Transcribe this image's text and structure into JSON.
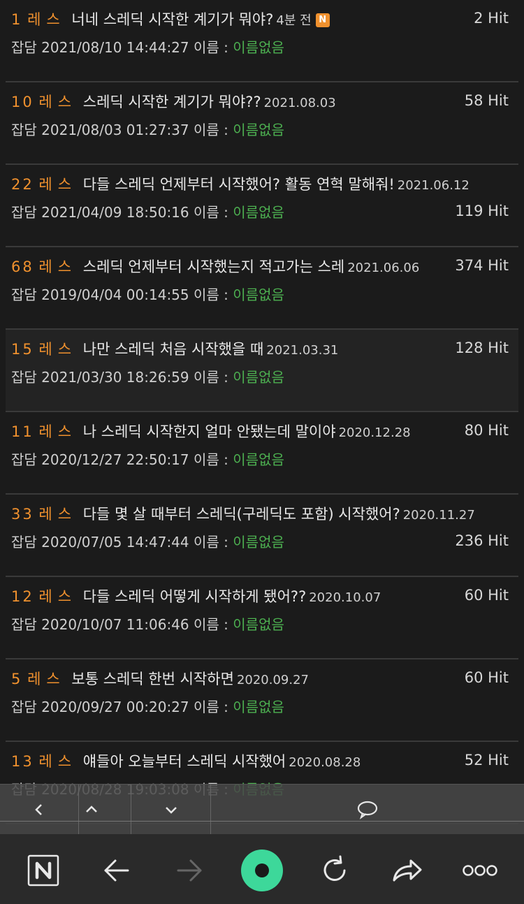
{
  "posts": [
    {
      "num": "1",
      "res": "레스",
      "title": "너네 스레딕 시작한 계기가 뭐야?",
      "date": "4분 전",
      "badge": "N",
      "hit": "2 Hit",
      "hit_pos": "top",
      "board": "잡담",
      "created": "2021/08/10 14:44:27",
      "name_label": "이름 :",
      "name": "이름없음",
      "highlight": false
    },
    {
      "num": "10",
      "res": "레스",
      "title": "스레딕 시작한 계기가 뭐야??",
      "date": "2021.08.03",
      "hit": "58 Hit",
      "hit_pos": "top",
      "board": "잡담",
      "created": "2021/08/03 01:27:37",
      "name_label": "이름 :",
      "name": "이름없음",
      "highlight": false
    },
    {
      "num": "22",
      "res": "레스",
      "title": "다들 스레딕 언제부터 시작했어? 활동 연혁 말해줘!",
      "date": "2021.06.12",
      "hit": "119 Hit",
      "hit_pos": "bottom",
      "board": "잡담",
      "created": "2021/04/09 18:50:16",
      "name_label": "이름 :",
      "name": "이름없음",
      "highlight": false
    },
    {
      "num": "68",
      "res": "레스",
      "title": "스레딕 언제부터 시작했는지 적고가는 스레",
      "date": "2021.06.06",
      "hit": "374 Hit",
      "hit_pos": "top",
      "board": "잡담",
      "created": "2019/04/04 00:14:55",
      "name_label": "이름 :",
      "name": "이름없음",
      "highlight": false
    },
    {
      "num": "15",
      "res": "레스",
      "title": "나만 스레딕 처음 시작했을 때",
      "date": "2021.03.31",
      "hit": "128 Hit",
      "hit_pos": "top",
      "board": "잡담",
      "created": "2021/03/30 18:26:59",
      "name_label": "이름 :",
      "name": "이름없음",
      "highlight": true
    },
    {
      "num": "11",
      "res": "레스",
      "title": "나 스레딕 시작한지 얼마 안됐는데 말이야",
      "date": "2020.12.28",
      "hit": "80 Hit",
      "hit_pos": "top",
      "board": "잡담",
      "created": "2020/12/27 22:50:17",
      "name_label": "이름 :",
      "name": "이름없음",
      "highlight": false
    },
    {
      "num": "33",
      "res": "레스",
      "title": "다들 몇 살 때부터 스레딕(구레딕도 포함) 시작했어?",
      "date": "2020.11.27",
      "hit": "236 Hit",
      "hit_pos": "bottom",
      "board": "잡담",
      "created": "2020/07/05 14:47:44",
      "name_label": "이름 :",
      "name": "이름없음",
      "highlight": false
    },
    {
      "num": "12",
      "res": "레스",
      "title": "다들 스레딕 어떻게 시작하게 됐어??",
      "date": "2020.10.07",
      "hit": "60 Hit",
      "hit_pos": "top",
      "board": "잡담",
      "created": "2020/10/07 11:06:46",
      "name_label": "이름 :",
      "name": "이름없음",
      "highlight": false
    },
    {
      "num": "5",
      "res": "레스",
      "title": "보통 스레딕 한번 시작하면",
      "date": "2020.09.27",
      "hit": "60 Hit",
      "hit_pos": "top",
      "board": "잡담",
      "created": "2020/09/27 00:20:27",
      "name_label": "이름 :",
      "name": "이름없음",
      "highlight": false
    },
    {
      "num": "13",
      "res": "레스",
      "title": "얘들아 오늘부터 스레딕 시작했어",
      "date": "2020.08.28",
      "hit": "52 Hit",
      "hit_pos": "top",
      "board": "잡담",
      "created": "2020/08/28 19:03:08",
      "name_label": "이름 :",
      "name": "이름없음",
      "highlight": false
    }
  ],
  "sub_toolbar": {
    "icons": [
      "chevron-left-icon",
      "chevron-up-icon",
      "chevron-down-icon",
      "comment-icon"
    ]
  },
  "bottom_nav": {
    "icons": [
      "naver-n-icon",
      "back-arrow-icon",
      "forward-arrow-icon",
      "green-dot-icon",
      "refresh-icon",
      "share-icon",
      "more-icon"
    ],
    "home_badge": "N"
  },
  "colors": {
    "accent_orange": "#f0912e",
    "name_green": "#4caf50",
    "background": "#1b1b1b",
    "green_button": "#3dd89a"
  }
}
